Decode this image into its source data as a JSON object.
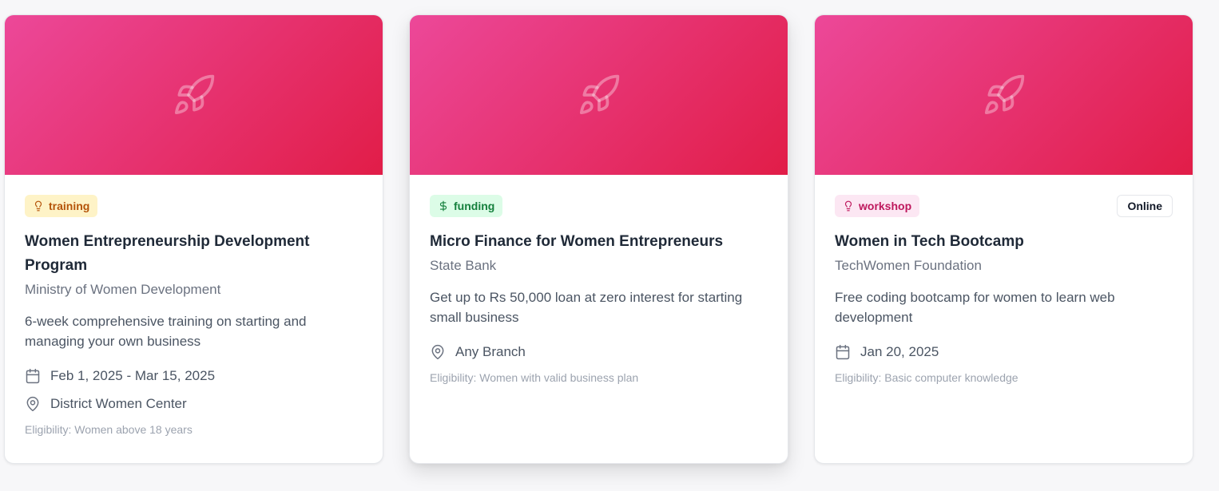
{
  "cards": [
    {
      "category": "training",
      "category_icon": "lightbulb-icon",
      "title": "Women Entrepreneurship Development Program",
      "organization": "Ministry of Women Development",
      "description": "6-week comprehensive training on starting and managing your own business",
      "date": "Feb 1, 2025 - Mar 15, 2025",
      "location": "District Women Center",
      "eligibility": "Eligibility: Women above 18 years"
    },
    {
      "category": "funding",
      "category_icon": "dollar-icon",
      "title": "Micro Finance for Women Entrepreneurs",
      "organization": "State Bank",
      "description": "Get up to Rs 50,000 loan at zero interest for starting small business",
      "location": "Any Branch",
      "eligibility": "Eligibility: Women with valid business plan"
    },
    {
      "category": "workshop",
      "category_icon": "lightbulb-icon",
      "mode": "Online",
      "title": "Women in Tech Bootcamp",
      "organization": "TechWomen Foundation",
      "description": "Free coding bootcamp for women to learn web development",
      "date": "Jan 20, 2025",
      "eligibility": "Eligibility: Basic computer knowledge"
    }
  ],
  "colors": {
    "banner_start": "#ec4899",
    "banner_end": "#e11d48",
    "training_bg": "#fef3c7",
    "funding_bg": "#dcfce7",
    "workshop_bg": "#fce7f3"
  }
}
